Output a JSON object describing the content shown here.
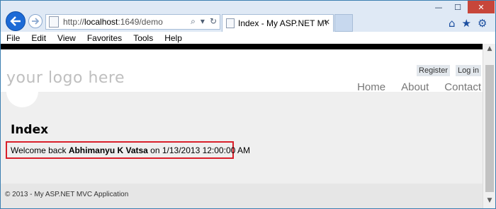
{
  "browser": {
    "address": {
      "protocol": "http://",
      "host": "localhost",
      "path": ":1649/demo"
    },
    "tab_title": "Index - My ASP.NET MVC A...",
    "icons": {
      "back": "back-arrow-icon",
      "forward": "forward-arrow-icon",
      "search": "search-icon",
      "refresh": "refresh-icon",
      "home": "home-icon",
      "favorites": "star-icon",
      "settings": "gear-icon"
    }
  },
  "menu": [
    "File",
    "Edit",
    "View",
    "Favorites",
    "Tools",
    "Help"
  ],
  "site": {
    "logo": "your logo here",
    "login": {
      "register": "Register",
      "login": "Log in"
    },
    "nav": [
      "Home",
      "About",
      "Contact"
    ],
    "page_title": "Index",
    "welcome": {
      "prefix": "Welcome back ",
      "user": "Abhimanyu K Vatsa",
      "suffix": " on 1/13/2013 12:00:00 AM"
    },
    "footer": "© 2013 - My ASP.NET MVC Application"
  }
}
